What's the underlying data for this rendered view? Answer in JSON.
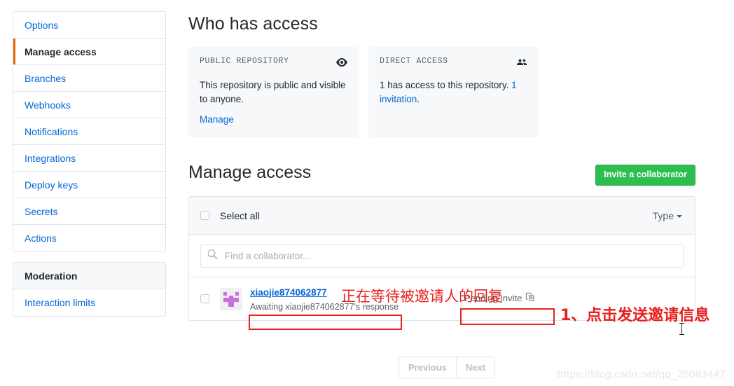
{
  "sidebar": {
    "items": [
      {
        "label": "Options",
        "selected": false
      },
      {
        "label": "Manage access",
        "selected": true
      },
      {
        "label": "Branches",
        "selected": false
      },
      {
        "label": "Webhooks",
        "selected": false
      },
      {
        "label": "Notifications",
        "selected": false
      },
      {
        "label": "Integrations",
        "selected": false
      },
      {
        "label": "Deploy keys",
        "selected": false
      },
      {
        "label": "Secrets",
        "selected": false
      },
      {
        "label": "Actions",
        "selected": false
      }
    ],
    "moderation_header": "Moderation",
    "moderation_items": [
      {
        "label": "Interaction limits"
      }
    ]
  },
  "who_has_access": {
    "heading": "Who has access",
    "cards": [
      {
        "title": "PUBLIC REPOSITORY",
        "icon": "eye-icon",
        "body": "This repository is public and visible to anyone.",
        "link": "Manage"
      },
      {
        "title": "DIRECT ACCESS",
        "icon": "people-icon",
        "body_prefix": "1 has access to this repository. ",
        "body_link": "1 invitation",
        "body_suffix": "."
      }
    ]
  },
  "manage_access": {
    "heading": "Manage access",
    "invite_button": "Invite a collaborator",
    "select_all_label": "Select all",
    "type_label": "Type",
    "search_placeholder": "Find a collaborator...",
    "search_value": "",
    "collaborators": [
      {
        "username": "xiaojie874062877",
        "status": "Awaiting xiaojie874062877's response",
        "badge": "Pending Invite"
      }
    ]
  },
  "pagination": {
    "previous": "Previous",
    "next": "Next"
  },
  "annotations": [
    {
      "text": "正在等待被邀请人的回复"
    },
    {
      "text": "1、点击发送邀请信息"
    }
  ],
  "watermark": "https://blog.csdn.net/qq_25083447",
  "colors": {
    "accent_orange": "#e36209",
    "link_blue": "#0366d6",
    "green_button": "#2cbe4e",
    "annotation_red": "#e8201f"
  }
}
